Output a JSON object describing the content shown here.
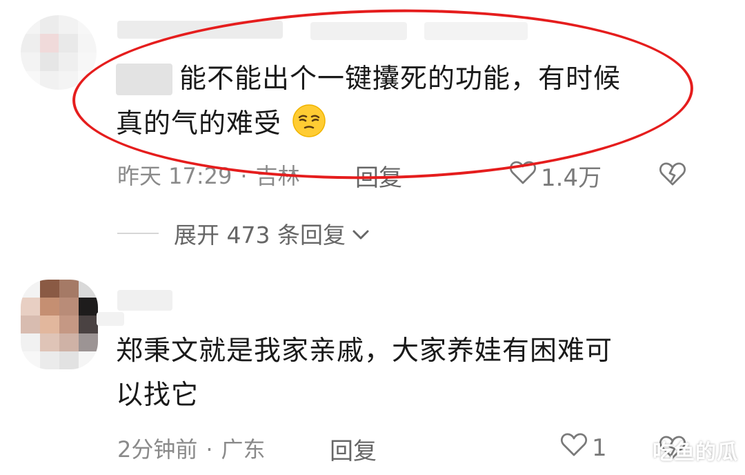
{
  "comments": [
    {
      "text_line1": "能不能出个一键攮死的功能，有时候",
      "text_line2": "真的气的难受",
      "emoji": "smirk-emoji",
      "time": "昨天 17:29",
      "location": "吉林",
      "reply_label": "回复",
      "likes": "1.4万"
    },
    {
      "text_line1": "郑秉文就是我家亲戚，大家养娃有困难可",
      "text_line2": "以找它",
      "time": "2分钟前",
      "location": "广东",
      "reply_label": "回复",
      "likes": "1"
    }
  ],
  "expand_replies_label": "展开 473 条回复",
  "watermark": "吃鱼的瓜",
  "colors": {
    "highlight_ellipse": "#e51d1d",
    "meta_text": "#8a8a8a",
    "body_text": "#1a1a1a"
  },
  "icons": {
    "like": "heart-outline-icon",
    "dislike": "broken-heart-icon",
    "expand": "chevron-down-icon"
  }
}
